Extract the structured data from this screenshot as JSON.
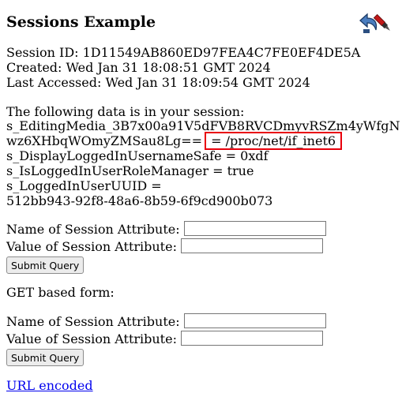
{
  "page": {
    "title": "Sessions Example"
  },
  "session": {
    "id_line": "Session ID: 1D11549AB860ED97FEA4C7FE0EF4DE5A",
    "created_line": "Created: Wed Jan 31 18:08:51 GMT 2024",
    "accessed_line": "Last Accessed: Wed Jan 31 18:09:54 GMT 2024"
  },
  "data_section": {
    "heading": "The following data is in your session:",
    "attr1_line1": "s_EditingMedia_3B7x00a91V5dFVB8RVCDmyvRSZm4yWfgN",
    "attr1_line2_prefix": "wz6XHbqWOmyZMSau8Lg== ",
    "attr1_value": "= /proc/net/if_inet6",
    "attr2": "s_DisplayLoggedInUsernameSafe = 0xdf",
    "attr3": "s_IsLoggedInUserRoleManager = true",
    "attr4_line1": "s_LoggedInUserUUID =",
    "attr4_line2": "512bb943-92f8-48a6-8b59-6f9cd900b073"
  },
  "post_form": {
    "name_label": "Name of Session Attribute:",
    "value_label": "Value of Session Attribute:",
    "name_value": "",
    "value_value": "",
    "submit_label": "Submit Query"
  },
  "get_form": {
    "heading": "GET based form:",
    "name_label": "Name of Session Attribute:",
    "value_label": "Value of Session Attribute:",
    "name_value": "",
    "value_value": "",
    "submit_label": "Submit Query"
  },
  "footer": {
    "link_label": "URL encoded"
  },
  "icons": [
    "return-arrow-icon",
    "edit-pen-icon"
  ],
  "colors": {
    "highlight_border": "#e8000b",
    "link": "#0000ee"
  }
}
